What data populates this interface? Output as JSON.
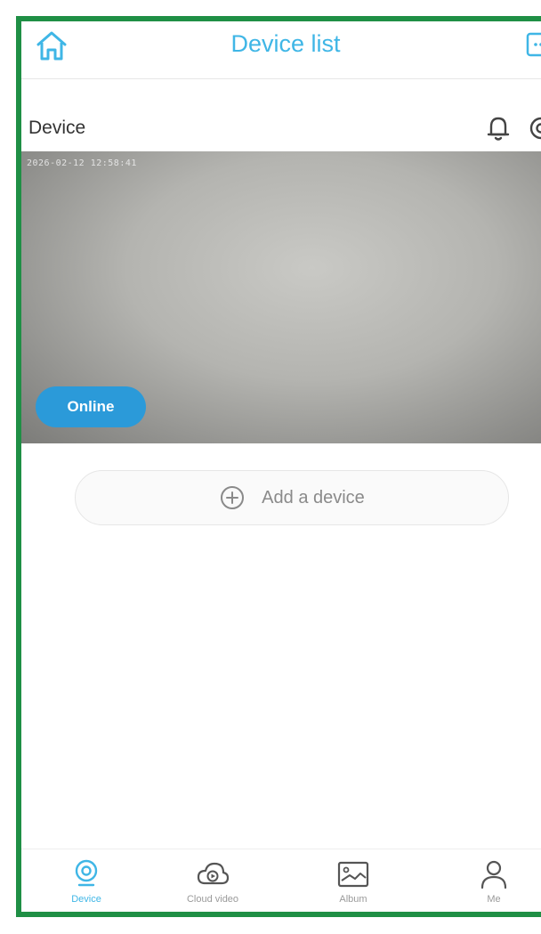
{
  "header": {
    "title": "Device list"
  },
  "device": {
    "section_title": "Device",
    "timestamp": "2026-02-12 12:58:41",
    "status": "Online"
  },
  "add_device": {
    "label": "Add a device"
  },
  "tabs": [
    {
      "label": "Device",
      "icon": "camera-tab-icon",
      "active": true
    },
    {
      "label": "Cloud video",
      "icon": "cloud-play-icon",
      "active": false
    },
    {
      "label": "Album",
      "icon": "album-icon",
      "active": false
    },
    {
      "label": "Me",
      "icon": "user-icon",
      "active": false
    }
  ],
  "colors": {
    "accent": "#3fb6e6",
    "online_badge": "#2b9ad9",
    "frame_border": "#1f8f45"
  }
}
